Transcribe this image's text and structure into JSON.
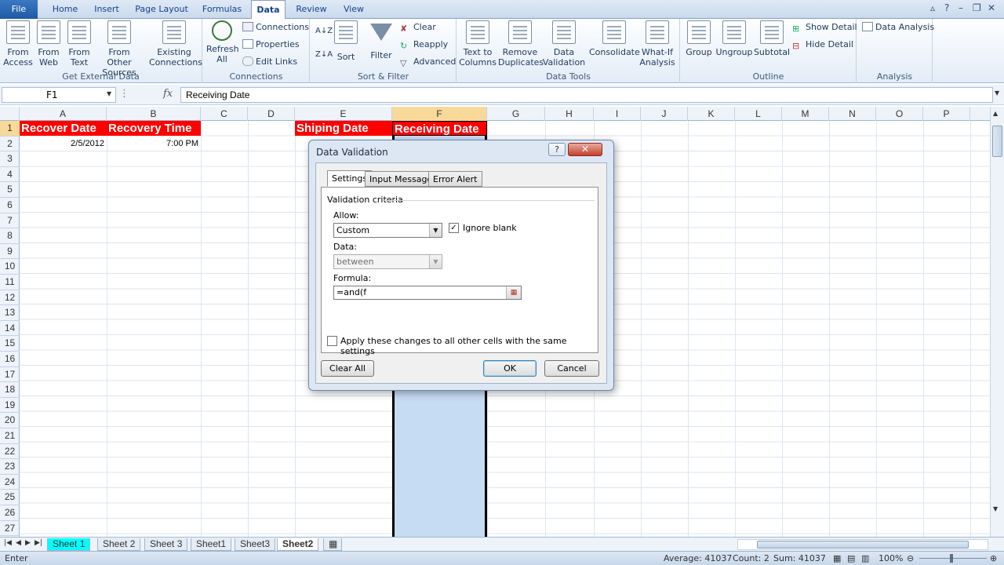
{
  "ribbon_tabs": [
    "File",
    "Home",
    "Insert",
    "Page Layout",
    "Formulas",
    "Data",
    "Review",
    "View"
  ],
  "active_tab": "Data",
  "ribbon": {
    "get_external_data": {
      "label": "Get External Data",
      "from_access": "From Access",
      "from_web": "From Web",
      "from_text": "From Text",
      "from_other_sources": "From Other Sources",
      "existing_connections": "Existing Connections"
    },
    "connections": {
      "label": "Connections",
      "refresh_all": "Refresh All",
      "connections": "Connections",
      "properties": "Properties",
      "edit_links": "Edit Links"
    },
    "sort_filter": {
      "label": "Sort & Filter",
      "sort": "Sort",
      "filter": "Filter",
      "clear": "Clear",
      "reapply": "Reapply",
      "advanced": "Advanced"
    },
    "data_tools": {
      "label": "Data Tools",
      "text_to_columns": "Text to Columns",
      "remove_duplicates": "Remove Duplicates",
      "data_validation": "Data Validation",
      "consolidate": "Consolidate",
      "what_if": "What-If Analysis"
    },
    "outline": {
      "label": "Outline",
      "group": "Group",
      "ungroup": "Ungroup",
      "subtotal": "Subtotal",
      "show_detail": "Show Detail",
      "hide_detail": "Hide Detail"
    },
    "analysis": {
      "label": "Analysis",
      "data_analysis": "Data Analysis"
    }
  },
  "formula_bar": {
    "name_box": "F1",
    "content": "Receiving Date"
  },
  "columns": [
    "A",
    "B",
    "C",
    "D",
    "E",
    "F",
    "G",
    "H",
    "I",
    "J",
    "K",
    "L",
    "M",
    "N",
    "O",
    "P"
  ],
  "rows": [
    "1",
    "2",
    "3",
    "4",
    "5",
    "6",
    "7",
    "8",
    "9",
    "10",
    "11",
    "12",
    "13",
    "14",
    "15",
    "16",
    "17",
    "18",
    "19",
    "20",
    "21",
    "22",
    "23",
    "24",
    "25",
    "26",
    "27"
  ],
  "cells": {
    "A1": "Recover Date",
    "B1": "Recovery Time",
    "E1": "Shiping Date",
    "F1": "Receiving Date",
    "A2": "2/5/2012",
    "B2": "7:00 PM"
  },
  "sheet_tabs": [
    "Sheet 1",
    "Sheet 2",
    "Sheet 3",
    "Sheet1",
    "Sheet3",
    "Sheet2"
  ],
  "status": {
    "mode": "Enter",
    "average": "Average: 41037",
    "count": "Count: 2",
    "sum": "Sum: 41037",
    "zoom": "100%"
  },
  "dialog": {
    "title": "Data Validation",
    "tabs": [
      "Settings",
      "Input Message",
      "Error Alert"
    ],
    "criteria_label": "Validation criteria",
    "allow_label": "Allow:",
    "allow_value": "Custom",
    "ignore_blank": "Ignore blank",
    "data_label": "Data:",
    "data_value": "between",
    "formula_label": "Formula:",
    "formula_value": "=and(f",
    "apply_all": "Apply these changes to all other cells with the same settings",
    "clear_all": "Clear All",
    "ok": "OK",
    "cancel": "Cancel"
  },
  "colors": {
    "header_fill": "#ff0000",
    "header_text": "#ffffff",
    "selection": "#c6dcf3"
  }
}
